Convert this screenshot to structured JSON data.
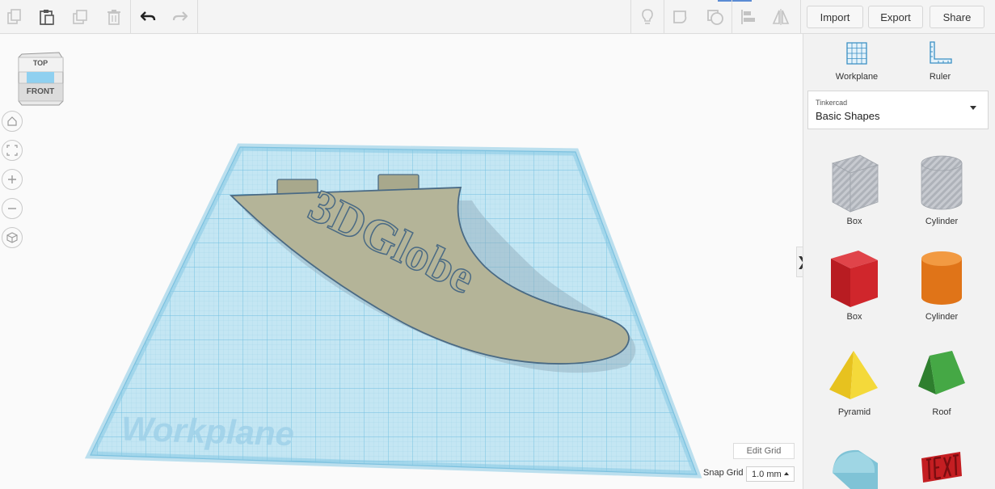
{
  "toolbar": {
    "import_label": "Import",
    "export_label": "Export",
    "share_label": "Share"
  },
  "view_cube": {
    "top_label": "TOP",
    "front_label": "FRONT"
  },
  "workplane": {
    "watermark": "Workplane",
    "text_3d": "3DGlobe"
  },
  "panel": {
    "tools": [
      {
        "label": "Workplane",
        "icon": "workplane-icon"
      },
      {
        "label": "Ruler",
        "icon": "ruler-icon"
      }
    ],
    "library": {
      "category": "Tinkercad",
      "selected": "Basic Shapes"
    },
    "shapes": [
      {
        "label": "Box",
        "icon": "box-hole-icon",
        "color": "#b9bcc2"
      },
      {
        "label": "Cylinder",
        "icon": "cylinder-hole-icon",
        "color": "#c4c6cb"
      },
      {
        "label": "Box",
        "icon": "box-icon",
        "color": "#d0262c"
      },
      {
        "label": "Cylinder",
        "icon": "cylinder-icon",
        "color": "#e57b1f"
      },
      {
        "label": "Pyramid",
        "icon": "pyramid-icon",
        "color": "#f1cf2c"
      },
      {
        "label": "Roof",
        "icon": "roof-icon",
        "color": "#3e9b3e"
      }
    ]
  },
  "grid": {
    "edit_grid_label": "Edit Grid",
    "snap_grid_label": "Snap Grid",
    "snap_value": "1.0 mm"
  },
  "colors": {
    "workplane_fill": "#bfe4f2",
    "grid_line": "#7fc6e3",
    "fin_fill": "#b4b498",
    "fin_outline": "#4a6a84"
  }
}
